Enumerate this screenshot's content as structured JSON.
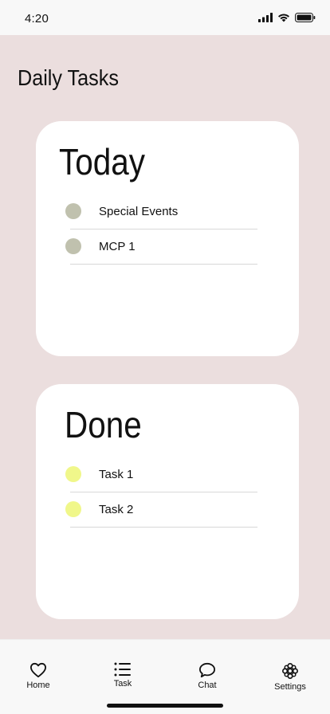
{
  "status_bar": {
    "time": "4:20"
  },
  "header": {
    "title": "Daily Tasks"
  },
  "cards": {
    "today": {
      "title": "Today",
      "items": [
        {
          "label": "Special Events",
          "dot_color": "#c0c1ae"
        },
        {
          "label": "MCP 1",
          "dot_color": "#c0c1ae"
        }
      ]
    },
    "done": {
      "title": "Done",
      "items": [
        {
          "label": "Task 1",
          "dot_color": "#f0f78a"
        },
        {
          "label": "Task 2",
          "dot_color": "#f0f78a"
        }
      ]
    }
  },
  "tab_bar": {
    "tabs": [
      {
        "label": "Home",
        "icon": "heart-icon"
      },
      {
        "label": "Task",
        "icon": "list-icon"
      },
      {
        "label": "Chat",
        "icon": "chat-bubble-icon"
      },
      {
        "label": "Settings",
        "icon": "flower-icon"
      }
    ]
  },
  "colors": {
    "background": "#ebdede",
    "card": "#ffffff",
    "today_dot": "#c0c1ae",
    "done_dot": "#f0f78a"
  }
}
